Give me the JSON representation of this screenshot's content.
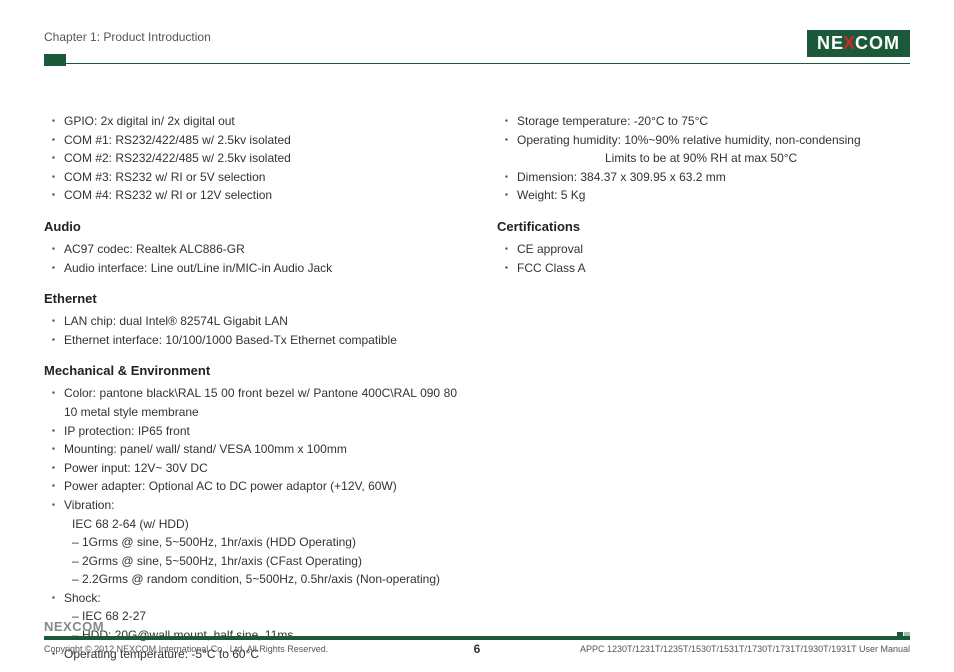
{
  "header": {
    "chapter": "Chapter 1: Product Introduction",
    "logo_pre": "NE",
    "logo_x": "X",
    "logo_post": "COM"
  },
  "left": {
    "io_items": [
      "GPIO: 2x digital in/ 2x digital out",
      "COM #1: RS232/422/485 w/ 2.5kv isolated",
      "COM #2: RS232/422/485 w/ 2.5kv isolated",
      "COM #3: RS232 w/ RI or 5V selection",
      "COM #4: RS232 w/ RI or 12V selection"
    ],
    "audio_heading": "Audio",
    "audio_items": [
      "AC97 codec: Realtek ALC886-GR",
      "Audio interface: Line out/Line in/MIC-in Audio Jack"
    ],
    "ethernet_heading": "Ethernet",
    "ethernet_items": [
      "LAN chip: dual Intel® 82574L Gigabit LAN",
      "Ethernet interface: 10/100/1000 Based-Tx Ethernet compatible"
    ],
    "mech_heading": "Mechanical & Environment",
    "mech_items": {
      "color": "Color: pantone black\\RAL 15 00 front bezel w/ Pantone 400C\\RAL 090 80 10 metal style membrane",
      "ip": "IP protection: IP65 front",
      "mount": "Mounting: panel/ wall/ stand/ VESA 100mm x 100mm",
      "power_in": "Power input: 12V~ 30V DC",
      "power_ad": "Power adapter: Optional AC to DC power adaptor (+12V, 60W)",
      "vibration_label": "Vibration:",
      "vibration_std": "IEC 68 2-64 (w/ HDD)",
      "vib1": "– 1Grms @ sine, 5~500Hz, 1hr/axis (HDD Operating)",
      "vib2": "– 2Grms @ sine, 5~500Hz, 1hr/axis (CFast Operating)",
      "vib3": "– 2.2Grms @ random condition, 5~500Hz, 0.5hr/axis (Non-operating)",
      "shock_label": "Shock:",
      "shock1": "– IEC 68 2-27",
      "shock2": "– HDD: 20G@wall mount, half sine, 11ms",
      "op_temp": "Operating temperature: -5°C to 60°C"
    }
  },
  "right": {
    "env_items": {
      "storage": "Storage temperature: -20°C to 75°C",
      "humidity": "Operating humidity: 10%~90% relative humidity, non-condensing",
      "humidity_sub": "Limits to be at 90% RH at max 50°C",
      "dimension": "Dimension: 384.37 x 309.95 x 63.2 mm",
      "weight": "Weight: 5 Kg"
    },
    "cert_heading": "Certifications",
    "cert_items": [
      "CE approval",
      "FCC Class A"
    ]
  },
  "footer": {
    "logo": "NEXCOM",
    "copyright": "Copyright © 2012 NEXCOM International Co., Ltd. All Rights Reserved.",
    "page": "6",
    "manual": "APPC 1230T/1231T/1235T/1530T/1531T/1730T/1731T/1930T/1931T User Manual"
  }
}
